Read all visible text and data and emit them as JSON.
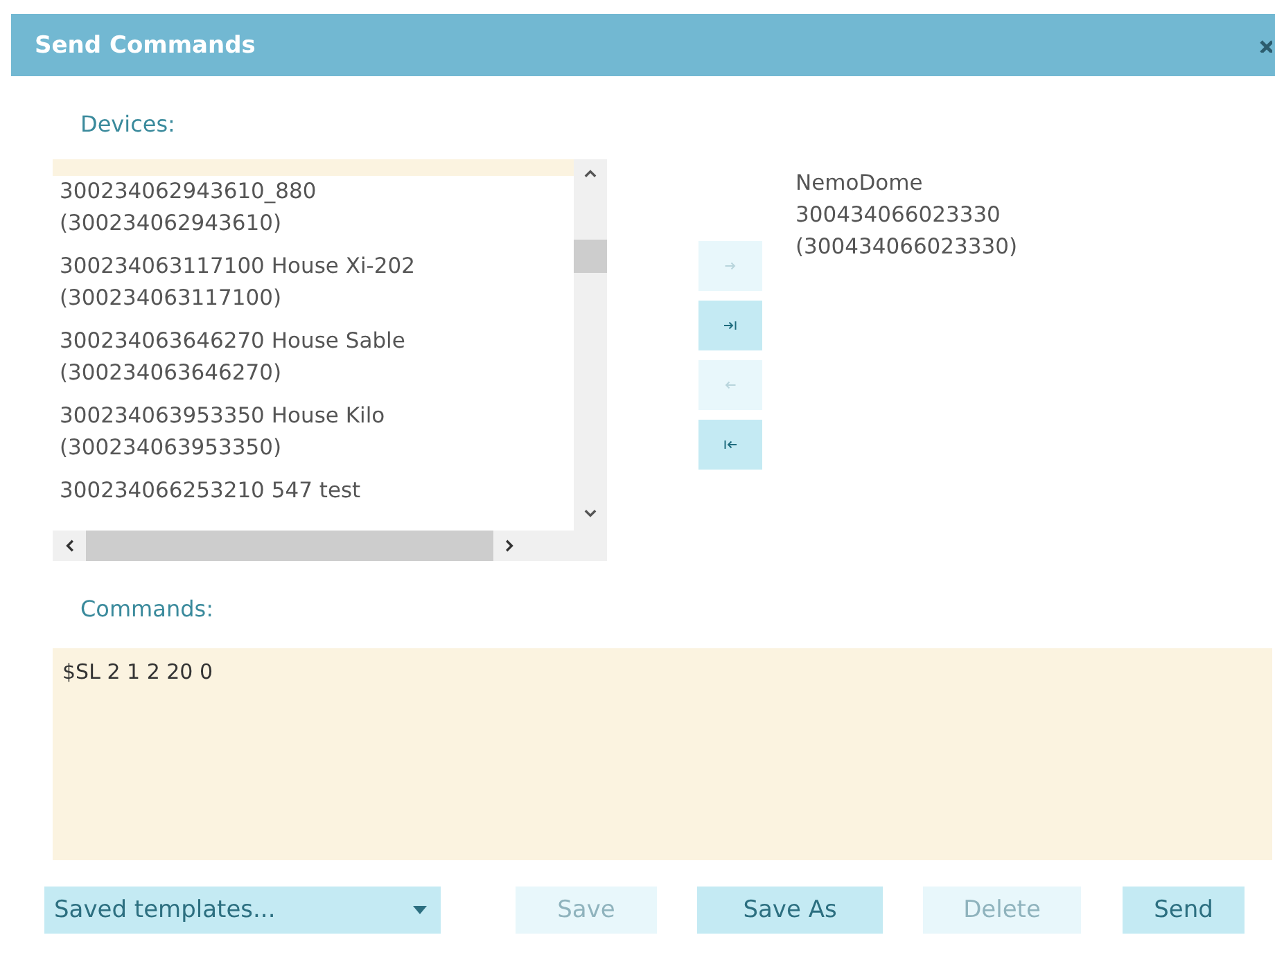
{
  "window": {
    "title": "Send Commands"
  },
  "devices": {
    "label": "Devices:",
    "items": [
      {
        "selected": true
      },
      {
        "lines": [
          "300234062943610_880",
          "(300234062943610)"
        ],
        "selected": false
      },
      {
        "lines": [
          "300234063117100 House Xi-202",
          "(300234063117100)"
        ],
        "selected": false
      },
      {
        "lines": [
          "300234063646270 House Sable",
          "(300234063646270)"
        ],
        "selected": false
      },
      {
        "lines": [
          "300234063953350 House Kilo",
          "(300234063953350)"
        ],
        "selected": false
      },
      {
        "lines": [
          "300234066253210 547 test"
        ],
        "selected": false
      }
    ]
  },
  "move_buttons": [
    {
      "kind": "add",
      "disabled": true
    },
    {
      "kind": "add_all",
      "disabled": false
    },
    {
      "kind": "remove",
      "disabled": true
    },
    {
      "kind": "remove_all",
      "disabled": false
    }
  ],
  "selected_devices": [
    {
      "lines": [
        "NemoDome",
        "300434066023330",
        "(300434066023330)"
      ]
    }
  ],
  "commands": {
    "label": "Commands:",
    "value": "$SL 2 1 2 20 0"
  },
  "templates": {
    "placeholder": "Saved templates..."
  },
  "buttons": [
    {
      "label": "Save",
      "disabled": true
    },
    {
      "label": "Save As",
      "disabled": false
    },
    {
      "label": "Delete",
      "disabled": true
    },
    {
      "label": "Send",
      "disabled": false
    }
  ]
}
